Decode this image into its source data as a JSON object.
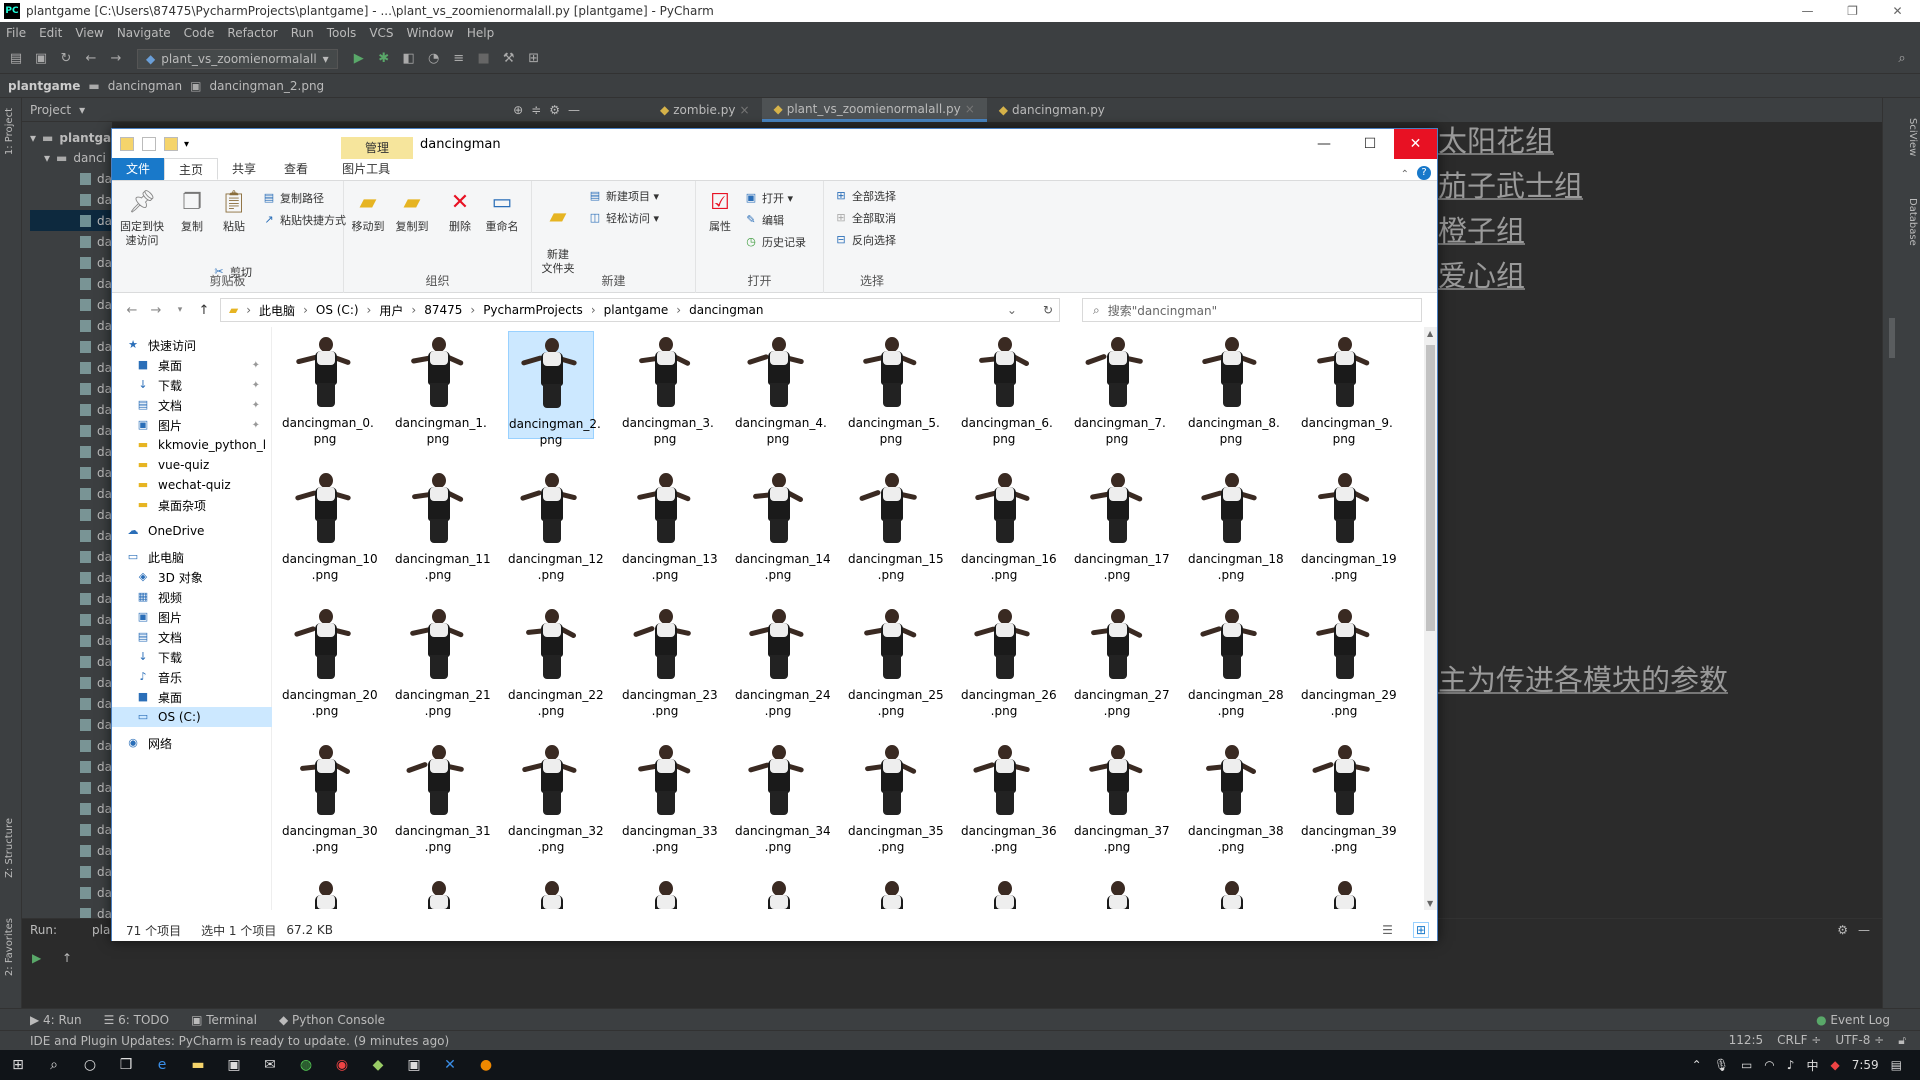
{
  "pycharm": {
    "title": "plantgame [C:\\Users\\87475\\PycharmProjects\\plantgame] - ...\\plant_vs_zoomienormalall.py [plantgame] - PyCharm",
    "menu": [
      "File",
      "Edit",
      "View",
      "Navigate",
      "Code",
      "Refactor",
      "Run",
      "Tools",
      "VCS",
      "Window",
      "Help"
    ],
    "run_config": "plant_vs_zoomienormalall",
    "breadcrumb": [
      "plantgame",
      "dancingman",
      "dancingman_2.png"
    ],
    "project_label": "Project",
    "tree_root": "plantga",
    "tree_sub": "danci",
    "tree_item": "da",
    "tabs": [
      "zombie.py",
      "plant_vs_zoomienormalall.py",
      "dancingman.py"
    ],
    "editor_text": [
      "太阳花组",
      "茄子武士组",
      "橙子组",
      "爱心组",
      "主为传进各模块的参数"
    ],
    "run_label": "Run:",
    "run_name": "pla",
    "tool_tabs": [
      "4: Run",
      "6: TODO",
      "Terminal",
      "Python Console"
    ],
    "event_log": "Event Log",
    "status_msg": "IDE and Plugin Updates: PyCharm is ready to update. (9 minutes ago)",
    "status_right": [
      "112:5",
      "CRLF ÷",
      "UTF-8 ÷"
    ],
    "side_labels": [
      "1: Project",
      "Z: Structure",
      "2: Favorites",
      "SciView",
      "Database"
    ]
  },
  "explorer": {
    "title": "dancingman",
    "manage_tab": "管理",
    "ribbon_tabs": [
      "文件",
      "主页",
      "共享",
      "查看",
      "图片工具"
    ],
    "clipboard": {
      "pin": "固定到快速访问",
      "copy": "复制",
      "paste": "粘贴",
      "copy_path": "复制路径",
      "paste_shortcut": "粘贴快捷方式",
      "cut": "剪切",
      "label": "剪贴板"
    },
    "organize": {
      "move": "移动到",
      "copyto": "复制到",
      "delete": "删除",
      "rename": "重命名",
      "label": "组织"
    },
    "new": {
      "folder": "新建\n文件夹",
      "item": "新建项目 ▾",
      "easy": "轻松访问 ▾",
      "label": "新建"
    },
    "open": {
      "props": "属性",
      "open": "打开 ▾",
      "edit": "编辑",
      "history": "历史记录",
      "label": "打开"
    },
    "select": {
      "all": "全部选择",
      "none": "全部取消",
      "invert": "反向选择",
      "label": "选择"
    },
    "address": [
      "此电脑",
      "OS (C:)",
      "用户",
      "87475",
      "PycharmProjects",
      "plantgame",
      "dancingman"
    ],
    "search_placeholder": "搜索\"dancingman\"",
    "nav": [
      {
        "label": "快速访问",
        "icon": "★",
        "pin": false
      },
      {
        "label": "桌面",
        "icon": "■",
        "pin": true
      },
      {
        "label": "下载",
        "icon": "↓",
        "pin": true
      },
      {
        "label": "文档",
        "icon": "▤",
        "pin": true
      },
      {
        "label": "图片",
        "icon": "▣",
        "pin": true
      },
      {
        "label": "kkmovie_python_l",
        "icon": "▬",
        "pin": false
      },
      {
        "label": "vue-quiz",
        "icon": "▬",
        "pin": false
      },
      {
        "label": "wechat-quiz",
        "icon": "▬",
        "pin": false
      },
      {
        "label": "桌面杂项",
        "icon": "▬",
        "pin": false
      },
      {
        "label": "OneDrive",
        "icon": "☁",
        "pin": false
      },
      {
        "label": "此电脑",
        "icon": "▭",
        "pin": false
      },
      {
        "label": "3D 对象",
        "icon": "◈",
        "pin": false
      },
      {
        "label": "视频",
        "icon": "▦",
        "pin": false
      },
      {
        "label": "图片",
        "icon": "▣",
        "pin": false
      },
      {
        "label": "文档",
        "icon": "▤",
        "pin": false
      },
      {
        "label": "下载",
        "icon": "↓",
        "pin": false
      },
      {
        "label": "音乐",
        "icon": "♪",
        "pin": false
      },
      {
        "label": "桌面",
        "icon": "■",
        "pin": false
      },
      {
        "label": "OS (C:)",
        "icon": "▭",
        "pin": false
      },
      {
        "label": "网络",
        "icon": "◉",
        "pin": false
      }
    ],
    "files": [
      [
        "dancingman_0.",
        "png"
      ],
      [
        "dancingman_1.",
        "png"
      ],
      [
        "dancingman_2.",
        "png"
      ],
      [
        "dancingman_3.",
        "png"
      ],
      [
        "dancingman_4.",
        "png"
      ],
      [
        "dancingman_5.",
        "png"
      ],
      [
        "dancingman_6.",
        "png"
      ],
      [
        "dancingman_7.",
        "png"
      ],
      [
        "dancingman_8.",
        "png"
      ],
      [
        "dancingman_9.",
        "png"
      ],
      [
        "dancingman_10",
        ".png"
      ],
      [
        "dancingman_11",
        ".png"
      ],
      [
        "dancingman_12",
        ".png"
      ],
      [
        "dancingman_13",
        ".png"
      ],
      [
        "dancingman_14",
        ".png"
      ],
      [
        "dancingman_15",
        ".png"
      ],
      [
        "dancingman_16",
        ".png"
      ],
      [
        "dancingman_17",
        ".png"
      ],
      [
        "dancingman_18",
        ".png"
      ],
      [
        "dancingman_19",
        ".png"
      ],
      [
        "dancingman_20",
        ".png"
      ],
      [
        "dancingman_21",
        ".png"
      ],
      [
        "dancingman_22",
        ".png"
      ],
      [
        "dancingman_23",
        ".png"
      ],
      [
        "dancingman_24",
        ".png"
      ],
      [
        "dancingman_25",
        ".png"
      ],
      [
        "dancingman_26",
        ".png"
      ],
      [
        "dancingman_27",
        ".png"
      ],
      [
        "dancingman_28",
        ".png"
      ],
      [
        "dancingman_29",
        ".png"
      ],
      [
        "dancingman_30",
        ".png"
      ],
      [
        "dancingman_31",
        ".png"
      ],
      [
        "dancingman_32",
        ".png"
      ],
      [
        "dancingman_33",
        ".png"
      ],
      [
        "dancingman_34",
        ".png"
      ],
      [
        "dancingman_35",
        ".png"
      ],
      [
        "dancingman_36",
        ".png"
      ],
      [
        "dancingman_37",
        ".png"
      ],
      [
        "dancingman_38",
        ".png"
      ],
      [
        "dancingman_39",
        ".png"
      ]
    ],
    "selected_index": 2,
    "status_count": "71 个项目",
    "status_selected": "选中 1 个项目",
    "status_size": "67.2 KB"
  },
  "taskbar": {
    "time": "7:59"
  },
  "colors": {
    "accent": "#1979ca",
    "close": "#e81123",
    "selection": "#cce8ff",
    "ide_bg": "#2b2b2b"
  }
}
